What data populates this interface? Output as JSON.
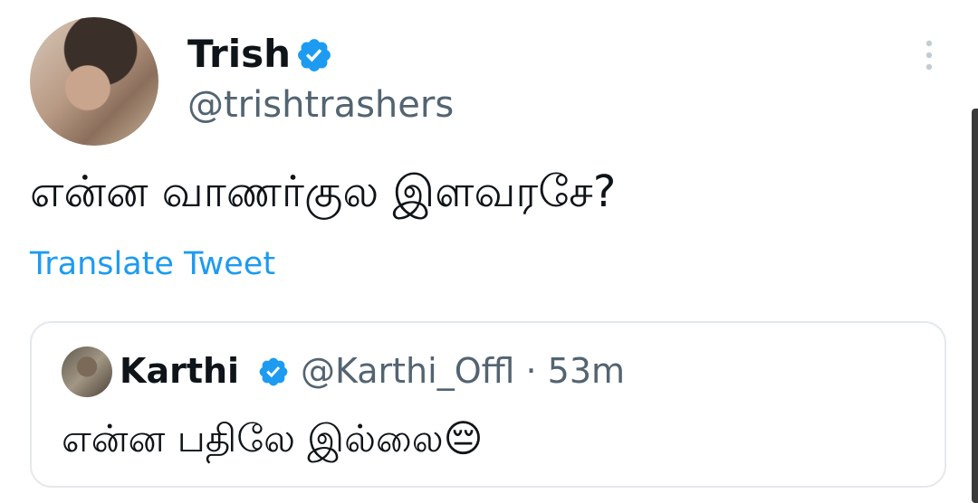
{
  "author": {
    "name": "Trish",
    "handle": "@trishtrashers",
    "verified": true
  },
  "tweet": {
    "text": "என்ன வாணர்குல இளவரசே?",
    "translate_label": "Translate Tweet"
  },
  "quoted_tweet": {
    "name": "Karthi",
    "handle": "@Karthi_Offl",
    "time": "53m",
    "separator": "·",
    "text": "என்ன பதிலே இல்லை",
    "emoji": "😔",
    "verified": true
  },
  "colors": {
    "accent": "#1d9bf0",
    "verified": "#1d9bf0",
    "secondary_text": "#536471",
    "border": "#e5e9ec"
  },
  "icons": {
    "verified": "verified-badge-icon",
    "more": "more-vertical-icon"
  }
}
